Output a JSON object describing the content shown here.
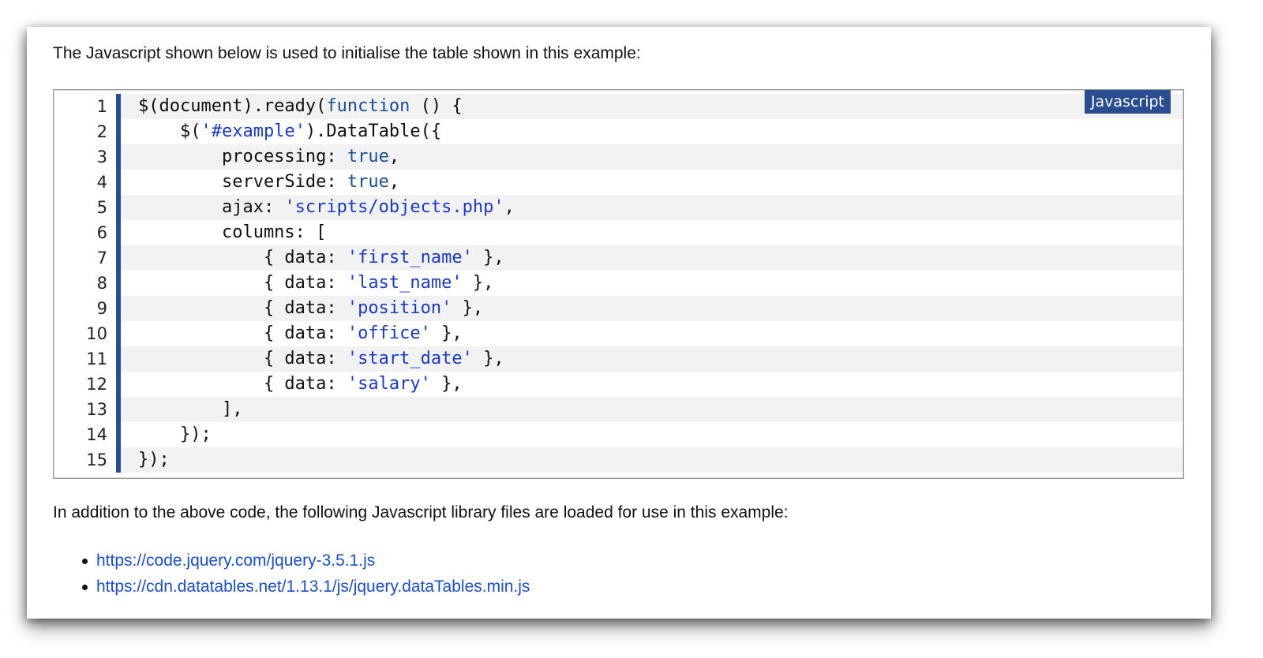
{
  "intro_text": "The Javascript shown below is used to initialise the table shown in this example:",
  "code_block": {
    "language_label": "Javascript",
    "lines": [
      {
        "num": "1",
        "tokens": [
          {
            "t": "p",
            "v": "$(document).ready("
          },
          {
            "t": "k",
            "v": "function"
          },
          {
            "t": "p",
            "v": " () {"
          }
        ]
      },
      {
        "num": "2",
        "tokens": [
          {
            "t": "p",
            "v": "    $("
          },
          {
            "t": "s",
            "v": "'#example'"
          },
          {
            "t": "p",
            "v": ").DataTable({"
          }
        ]
      },
      {
        "num": "3",
        "tokens": [
          {
            "t": "p",
            "v": "        processing: "
          },
          {
            "t": "k",
            "v": "true"
          },
          {
            "t": "p",
            "v": ","
          }
        ]
      },
      {
        "num": "4",
        "tokens": [
          {
            "t": "p",
            "v": "        serverSide: "
          },
          {
            "t": "k",
            "v": "true"
          },
          {
            "t": "p",
            "v": ","
          }
        ]
      },
      {
        "num": "5",
        "tokens": [
          {
            "t": "p",
            "v": "        ajax: "
          },
          {
            "t": "s",
            "v": "'scripts/objects.php'"
          },
          {
            "t": "p",
            "v": ","
          }
        ]
      },
      {
        "num": "6",
        "tokens": [
          {
            "t": "p",
            "v": "        columns: ["
          }
        ]
      },
      {
        "num": "7",
        "tokens": [
          {
            "t": "p",
            "v": "            { data: "
          },
          {
            "t": "s",
            "v": "'first_name'"
          },
          {
            "t": "p",
            "v": " },"
          }
        ]
      },
      {
        "num": "8",
        "tokens": [
          {
            "t": "p",
            "v": "            { data: "
          },
          {
            "t": "s",
            "v": "'last_name'"
          },
          {
            "t": "p",
            "v": " },"
          }
        ]
      },
      {
        "num": "9",
        "tokens": [
          {
            "t": "p",
            "v": "            { data: "
          },
          {
            "t": "s",
            "v": "'position'"
          },
          {
            "t": "p",
            "v": " },"
          }
        ]
      },
      {
        "num": "10",
        "tokens": [
          {
            "t": "p",
            "v": "            { data: "
          },
          {
            "t": "s",
            "v": "'office'"
          },
          {
            "t": "p",
            "v": " },"
          }
        ]
      },
      {
        "num": "11",
        "tokens": [
          {
            "t": "p",
            "v": "            { data: "
          },
          {
            "t": "s",
            "v": "'start_date'"
          },
          {
            "t": "p",
            "v": " },"
          }
        ]
      },
      {
        "num": "12",
        "tokens": [
          {
            "t": "p",
            "v": "            { data: "
          },
          {
            "t": "s",
            "v": "'salary'"
          },
          {
            "t": "p",
            "v": " },"
          }
        ]
      },
      {
        "num": "13",
        "tokens": [
          {
            "t": "p",
            "v": "        ],"
          }
        ]
      },
      {
        "num": "14",
        "tokens": [
          {
            "t": "p",
            "v": "    });"
          }
        ]
      },
      {
        "num": "15",
        "tokens": [
          {
            "t": "p",
            "v": "});"
          }
        ]
      }
    ]
  },
  "after_text": "In addition to the above code, the following Javascript library files are loaded for use in this example:",
  "libraries": [
    "https://code.jquery.com/jquery-3.5.1.js",
    "https://cdn.datatables.net/1.13.1/js/jquery.dataTables.min.js"
  ],
  "colors": {
    "accent": "#2a4d8f",
    "keyword": "#1a4f8f",
    "string": "#1a39c8",
    "link": "#1a4fc8",
    "stripe": "#f2f2f2"
  }
}
